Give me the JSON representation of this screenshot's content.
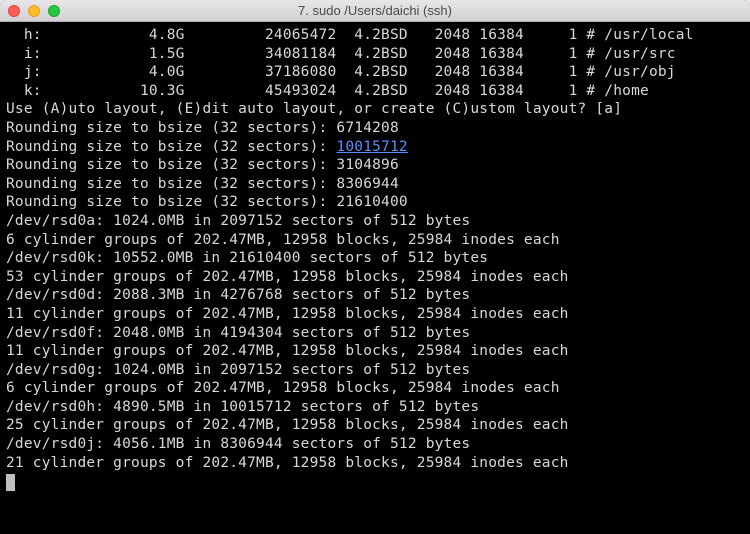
{
  "window": {
    "title": "7. sudo  /Users/daichi (ssh)"
  },
  "partitions": [
    {
      "letter": "h:",
      "size": "4.8G",
      "sectors": "24065472",
      "fs": "4.2BSD",
      "bsize": "2048",
      "fsize": "16384",
      "cpg": "1",
      "hash": "#",
      "mount": "/usr/local"
    },
    {
      "letter": "i:",
      "size": "1.5G",
      "sectors": "34081184",
      "fs": "4.2BSD",
      "bsize": "2048",
      "fsize": "16384",
      "cpg": "1",
      "hash": "#",
      "mount": "/usr/src"
    },
    {
      "letter": "j:",
      "size": "4.0G",
      "sectors": "37186080",
      "fs": "4.2BSD",
      "bsize": "2048",
      "fsize": "16384",
      "cpg": "1",
      "hash": "#",
      "mount": "/usr/obj"
    },
    {
      "letter": "k:",
      "size": "10.3G",
      "sectors": "45493024",
      "fs": "4.2BSD",
      "bsize": "2048",
      "fsize": "16384",
      "cpg": "1",
      "hash": "#",
      "mount": "/home"
    }
  ],
  "prompt": "Use (A)uto layout, (E)dit auto layout, or create (C)ustom layout? [a]",
  "rounding": [
    {
      "prefix": "Rounding size to bsize (32 sectors): ",
      "value": "6714208",
      "hl": false
    },
    {
      "prefix": "Rounding size to bsize (32 sectors): ",
      "value": "10015712",
      "hl": true
    },
    {
      "prefix": "Rounding size to bsize (32 sectors): ",
      "value": "3104896",
      "hl": false
    },
    {
      "prefix": "Rounding size to bsize (32 sectors): ",
      "value": "8306944",
      "hl": false
    },
    {
      "prefix": "Rounding size to bsize (32 sectors): ",
      "value": "21610400",
      "hl": false
    }
  ],
  "fsinfo": [
    "/dev/rsd0a: 1024.0MB in 2097152 sectors of 512 bytes",
    "6 cylinder groups of 202.47MB, 12958 blocks, 25984 inodes each",
    "/dev/rsd0k: 10552.0MB in 21610400 sectors of 512 bytes",
    "53 cylinder groups of 202.47MB, 12958 blocks, 25984 inodes each",
    "/dev/rsd0d: 2088.3MB in 4276768 sectors of 512 bytes",
    "11 cylinder groups of 202.47MB, 12958 blocks, 25984 inodes each",
    "/dev/rsd0f: 2048.0MB in 4194304 sectors of 512 bytes",
    "11 cylinder groups of 202.47MB, 12958 blocks, 25984 inodes each",
    "/dev/rsd0g: 1024.0MB in 2097152 sectors of 512 bytes",
    "6 cylinder groups of 202.47MB, 12958 blocks, 25984 inodes each",
    "/dev/rsd0h: 4890.5MB in 10015712 sectors of 512 bytes",
    "25 cylinder groups of 202.47MB, 12958 blocks, 25984 inodes each",
    "/dev/rsd0j: 4056.1MB in 8306944 sectors of 512 bytes",
    "21 cylinder groups of 202.47MB, 12958 blocks, 25984 inodes each"
  ]
}
